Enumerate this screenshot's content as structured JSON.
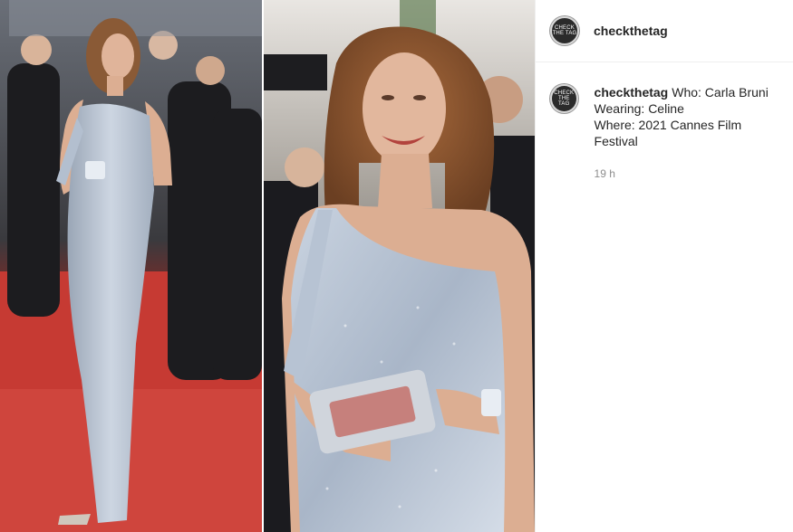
{
  "post": {
    "username": "checkthetag",
    "avatar_text": "CHECK THE TAG"
  },
  "caption": {
    "username": "checkthetag",
    "lines": [
      "Who: Carla Bruni",
      "Wearing: Celine",
      "Where: 2021 Cannes Film Festival"
    ],
    "time": "19 h"
  },
  "images": [
    {
      "name": "left-photo",
      "icon": "full-length-red-carpet-photo"
    },
    {
      "name": "right-photo",
      "icon": "close-up-red-carpet-photo"
    }
  ],
  "colors": {
    "carpet_red": "#c63a33",
    "gown_silver": "#b8c4d4",
    "border": "#efefef",
    "muted_text": "#8e8e8e"
  }
}
